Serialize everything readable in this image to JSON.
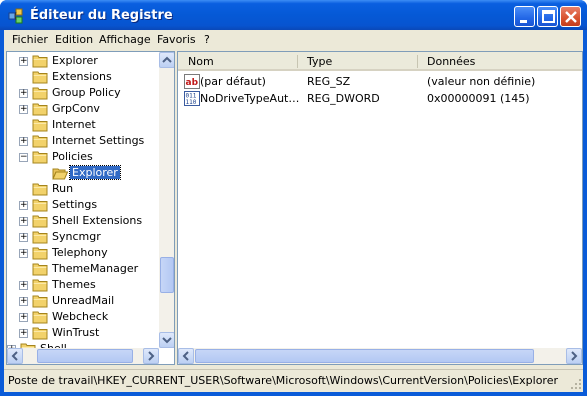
{
  "window": {
    "title": "Éditeur du Registre"
  },
  "menu": [
    "Fichier",
    "Edition",
    "Affichage",
    "Favoris",
    "?"
  ],
  "tree": {
    "items": [
      {
        "label": "Explorer",
        "expandable": true,
        "expanded": false,
        "level": 1
      },
      {
        "label": "Extensions",
        "expandable": false,
        "expanded": false,
        "level": 1
      },
      {
        "label": "Group Policy",
        "expandable": true,
        "expanded": false,
        "level": 1
      },
      {
        "label": "GrpConv",
        "expandable": true,
        "expanded": false,
        "level": 1
      },
      {
        "label": "Internet",
        "expandable": false,
        "expanded": false,
        "level": 1
      },
      {
        "label": "Internet Settings",
        "expandable": true,
        "expanded": false,
        "level": 1
      },
      {
        "label": "Policies",
        "expandable": true,
        "expanded": true,
        "level": 1
      },
      {
        "label": "Explorer",
        "expandable": false,
        "expanded": false,
        "level": 2,
        "selected": true
      },
      {
        "label": "Run",
        "expandable": false,
        "expanded": false,
        "level": 1
      },
      {
        "label": "Settings",
        "expandable": true,
        "expanded": false,
        "level": 1
      },
      {
        "label": "Shell Extensions",
        "expandable": true,
        "expanded": false,
        "level": 1
      },
      {
        "label": "Syncmgr",
        "expandable": true,
        "expanded": false,
        "level": 1
      },
      {
        "label": "Telephony",
        "expandable": true,
        "expanded": false,
        "level": 1
      },
      {
        "label": "ThemeManager",
        "expandable": false,
        "expanded": false,
        "level": 1
      },
      {
        "label": "Themes",
        "expandable": true,
        "expanded": false,
        "level": 1
      },
      {
        "label": "UnreadMail",
        "expandable": true,
        "expanded": false,
        "level": 1
      },
      {
        "label": "Webcheck",
        "expandable": true,
        "expanded": false,
        "level": 1
      },
      {
        "label": "WinTrust",
        "expandable": true,
        "expanded": false,
        "level": 1
      },
      {
        "label": "Shell",
        "expandable": true,
        "expanded": false,
        "level": 0
      }
    ]
  },
  "list": {
    "columns": [
      "Nom",
      "Type",
      "Données"
    ],
    "rows": [
      {
        "icon": "string-value-icon",
        "name": "(par défaut)",
        "type": "REG_SZ",
        "data": "(valeur non définie)"
      },
      {
        "icon": "binary-value-icon",
        "name": "NoDriveTypeAut…",
        "type": "REG_DWORD",
        "data": "0x00000091 (145)"
      }
    ]
  },
  "status": {
    "path": "Poste de travail\\HKEY_CURRENT_USER\\Software\\Microsoft\\Windows\\CurrentVersion\\Policies\\Explorer"
  },
  "colors": {
    "titlebar": "#0559d6",
    "selection": "#316ac5",
    "folder": "#f2d26b"
  }
}
